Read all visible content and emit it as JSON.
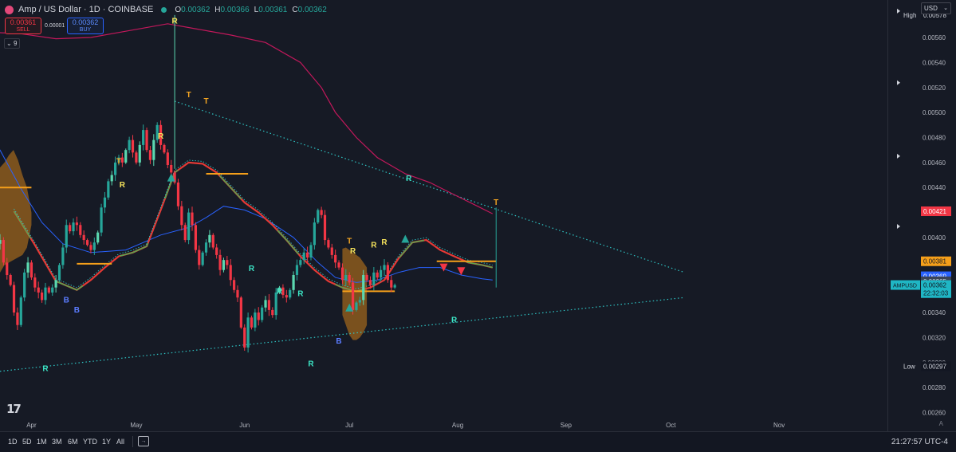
{
  "header": {
    "symbol_title": "Amp / US Dollar · 1D · COINBASE",
    "ohlc": [
      {
        "key": "O",
        "value": "0.00362"
      },
      {
        "key": "H",
        "value": "0.00366"
      },
      {
        "key": "L",
        "value": "0.00361"
      },
      {
        "key": "C",
        "value": "0.00362"
      }
    ],
    "sell_price": "0.00361",
    "sell_label": "SELL",
    "buy_price": "0.00362",
    "buy_label": "BUY",
    "spread": "0.00001",
    "indicator_count": "9",
    "currency": "USD"
  },
  "time_range_buttons": [
    "1D",
    "5D",
    "1M",
    "3M",
    "6M",
    "YTD",
    "1Y",
    "All"
  ],
  "clock": "21:27:57 UTC-4",
  "colors": {
    "background": "#161a25",
    "up": "#26a69a",
    "up_light": "#5bd8b0",
    "down": "#f23645",
    "ma_slow": "#c2185b",
    "ma_mid": "#2962ff",
    "ma_fast_up": "#4caf50",
    "ma_fast_down": "#e53935",
    "trendline": "#2ec4c4",
    "level_orange": "#f59f1a",
    "signal_T": "#f5a623",
    "signal_R_up": "#3ce6c6",
    "signal_R_top": "#f5e25b",
    "signal_B": "#5b7cff"
  },
  "chart_data": {
    "type": "candlestick",
    "title": "Amp / US Dollar · 1D · COINBASE",
    "symbol": "AMPUSD",
    "y_axis": {
      "ticks": [
        "0.00560",
        "0.00540",
        "0.00520",
        "0.00500",
        "0.00480",
        "0.00460",
        "0.00440",
        "0.00420",
        "0.00400",
        "0.00380",
        "0.00360",
        "0.00340",
        "0.00320",
        "0.00300",
        "0.00280",
        "0.00260"
      ],
      "ylim": [
        0.00245,
        0.0059
      ]
    },
    "x_axis": {
      "ticks": [
        {
          "label": "Apr",
          "day": 13
        },
        {
          "label": "May",
          "day": 43
        },
        {
          "label": "Jun",
          "day": 74
        },
        {
          "label": "Jul",
          "day": 104
        },
        {
          "label": "Aug",
          "day": 135
        },
        {
          "label": "Sep",
          "day": 166
        },
        {
          "label": "Oct",
          "day": 196
        },
        {
          "label": "Nov",
          "day": 227
        }
      ],
      "xlim": [
        4,
        258
      ]
    },
    "price_labels": [
      {
        "text": "0.00578",
        "prefix": "High",
        "value": 0.00578,
        "kind": "high"
      },
      {
        "text": "0.00421",
        "value": 0.00421,
        "kind": "red"
      },
      {
        "text": "0.00381",
        "value": 0.00381,
        "kind": "orange"
      },
      {
        "text": "0.00369",
        "value": 0.00369,
        "kind": "blue"
      },
      {
        "text": "0.00365",
        "value": 0.00365,
        "kind": "slate"
      },
      {
        "text": "0.00362",
        "value": 0.00362,
        "kind": "cyan"
      },
      {
        "text": "22:32:03",
        "value": 0.003555,
        "kind": "cyan-time"
      },
      {
        "text": "0.00297",
        "prefix": "Low",
        "value": 0.00297,
        "kind": "low"
      }
    ],
    "symbol_tag": {
      "text": "AMPUSD",
      "value": 0.00362
    },
    "closes": [
      0.00418,
      0.00428,
      0.0041,
      0.0042,
      0.00412,
      0.004,
      0.00415,
      0.00395,
      0.00398,
      0.0038,
      0.0037,
      0.00362,
      0.0034,
      0.0033,
      0.00352,
      0.00372,
      0.0038,
      0.00368,
      0.0036,
      0.00356,
      0.0035,
      0.0036,
      0.00356,
      0.0036,
      0.00366,
      0.00378,
      0.00392,
      0.0041,
      0.00405,
      0.00412,
      0.0041,
      0.00402,
      0.00398,
      0.00394,
      0.0039,
      0.00396,
      0.00404,
      0.00424,
      0.00432,
      0.00445,
      0.0045,
      0.0046,
      0.00464,
      0.0046,
      0.0047,
      0.00478,
      0.00468,
      0.0046,
      0.00474,
      0.00486,
      0.0047,
      0.00462,
      0.00478,
      0.0049,
      0.00474,
      0.00468,
      0.00458,
      0.00452,
      0.00444,
      0.00425,
      0.0041,
      0.00398,
      0.0042,
      0.0041,
      0.0039,
      0.00378,
      0.00388,
      0.00396,
      0.00402,
      0.00392,
      0.00386,
      0.00374,
      0.00382,
      0.00378,
      0.00366,
      0.00358,
      0.00352,
      0.00328,
      0.00312,
      0.00336,
      0.00328,
      0.0034,
      0.00334,
      0.00344,
      0.0035,
      0.00342,
      0.00338,
      0.00356,
      0.0036,
      0.00354,
      0.00352,
      0.00358,
      0.0037,
      0.00378,
      0.00382,
      0.00388,
      0.00384,
      0.00394,
      0.00412,
      0.00422,
      0.00418,
      0.00398,
      0.00392,
      0.00386,
      0.0038,
      0.00376,
      0.00366,
      0.0037,
      0.00364,
      0.00342,
      0.00348,
      0.0035,
      0.0037,
      0.00366,
      0.00362,
      0.00372,
      0.00368,
      0.00374,
      0.00378,
      0.00366,
      0.0036,
      0.00362
    ],
    "first_close_day": -4,
    "moving_averages": [
      {
        "name": "MA slow",
        "color_key": "ma_slow",
        "points": [
          [
            -4,
            0.00565
          ],
          [
            10,
            0.00563
          ],
          [
            20,
            0.00559
          ],
          [
            30,
            0.0056
          ],
          [
            40,
            0.00565
          ],
          [
            52,
            0.00571
          ],
          [
            60,
            0.00567
          ],
          [
            70,
            0.00562
          ],
          [
            80,
            0.00556
          ],
          [
            90,
            0.0054
          ],
          [
            96,
            0.0052
          ],
          [
            100,
            0.005
          ],
          [
            106,
            0.0048
          ],
          [
            112,
            0.00464
          ],
          [
            120,
            0.00451
          ],
          [
            127,
            0.00444
          ],
          [
            132,
            0.00437
          ],
          [
            140,
            0.00426
          ],
          [
            145,
            0.00419
          ]
        ]
      },
      {
        "name": "MA mid",
        "color_key": "ma_mid",
        "points": [
          [
            -4,
            0.00501
          ],
          [
            4,
            0.0047
          ],
          [
            10,
            0.00439
          ],
          [
            16,
            0.00412
          ],
          [
            22,
            0.00395
          ],
          [
            30,
            0.00388
          ],
          [
            40,
            0.0039
          ],
          [
            50,
            0.00402
          ],
          [
            58,
            0.00408
          ],
          [
            63,
            0.00416
          ],
          [
            68,
            0.00425
          ],
          [
            74,
            0.00422
          ],
          [
            80,
            0.00415
          ],
          [
            88,
            0.004
          ],
          [
            95,
            0.0038
          ],
          [
            100,
            0.00368
          ],
          [
            106,
            0.00364
          ],
          [
            112,
            0.00366
          ],
          [
            118,
            0.00372
          ],
          [
            124,
            0.00376
          ],
          [
            130,
            0.00376
          ],
          [
            136,
            0.0037
          ],
          [
            142,
            0.00367
          ],
          [
            145,
            0.00366
          ]
        ]
      },
      {
        "name": "MA fast",
        "color_key": "ma_fast_down",
        "points": [
          [
            8,
            0.00421
          ],
          [
            14,
            0.00394
          ],
          [
            20,
            0.00365
          ],
          [
            26,
            0.00358
          ],
          [
            30,
            0.00366
          ],
          [
            34,
            0.00376
          ],
          [
            38,
            0.00385
          ],
          [
            42,
            0.00388
          ],
          [
            46,
            0.00393
          ],
          [
            50,
            0.00422
          ],
          [
            54,
            0.00452
          ],
          [
            58,
            0.0046
          ],
          [
            62,
            0.00459
          ],
          [
            66,
            0.00452
          ],
          [
            70,
            0.0044
          ],
          [
            74,
            0.00428
          ],
          [
            78,
            0.0042
          ],
          [
            82,
            0.0041
          ],
          [
            86,
            0.00398
          ],
          [
            90,
            0.00385
          ],
          [
            94,
            0.00374
          ],
          [
            98,
            0.00365
          ],
          [
            102,
            0.0036
          ],
          [
            106,
            0.00357
          ],
          [
            110,
            0.0036
          ],
          [
            114,
            0.00366
          ],
          [
            118,
            0.00383
          ],
          [
            122,
            0.00396
          ],
          [
            126,
            0.00398
          ],
          [
            130,
            0.0039
          ],
          [
            134,
            0.00385
          ],
          [
            138,
            0.0038
          ],
          [
            142,
            0.00378
          ],
          [
            145,
            0.00376
          ]
        ]
      }
    ],
    "trendlines": [
      {
        "name": "upper",
        "from": [
          54,
          0.00509
        ],
        "to": [
          200,
          0.00372
        ]
      },
      {
        "name": "lower",
        "from": [
          4,
          0.00293
        ],
        "to": [
          200,
          0.00352
        ]
      }
    ],
    "levels": [
      {
        "value": 0.0044,
        "from": 4,
        "to": 13
      },
      {
        "value": 0.00379,
        "from": 26,
        "to": 36
      },
      {
        "value": 0.00451,
        "from": 63,
        "to": 75
      },
      {
        "value": 0.00357,
        "from": 102,
        "to": 117
      },
      {
        "value": 0.00381,
        "from": 129,
        "to": 146
      }
    ],
    "cloud_bands": [
      {
        "from": 4,
        "to": 13,
        "top": [
          0.00456,
          0.0046,
          0.00466,
          0.0047,
          0.00462,
          0.0045,
          0.0044,
          0.0042
        ],
        "bottom": [
          0.00372,
          0.00378,
          0.0038,
          0.00382,
          0.00384,
          0.00386,
          0.00392,
          0.0041
        ]
      },
      {
        "from": 102,
        "to": 109,
        "top": [
          0.00391,
          0.00392,
          0.0039,
          0.00388,
          0.00386,
          0.00384,
          0.0038,
          0.00376
        ],
        "bottom": [
          0.00338,
          0.0033,
          0.00322,
          0.00318,
          0.00318,
          0.0032,
          0.00324,
          0.0033
        ]
      }
    ],
    "signals": [
      {
        "text": "R",
        "day": 54,
        "value": 0.00573,
        "color_key": "signal_R_top"
      },
      {
        "text": "T",
        "day": 58,
        "value": 0.00514,
        "color_key": "signal_T"
      },
      {
        "text": "T",
        "day": 63,
        "value": 0.00509,
        "color_key": "signal_T"
      },
      {
        "text": "R",
        "day": 50,
        "value": 0.00481,
        "color_key": "signal_R_top"
      },
      {
        "text": "T",
        "day": 38,
        "value": 0.00461,
        "color_key": "signal_T"
      },
      {
        "text": "R",
        "day": 39,
        "value": 0.00442,
        "color_key": "signal_R_top"
      },
      {
        "text": "R",
        "day": 121,
        "value": 0.00447,
        "color_key": "signal_R_up"
      },
      {
        "text": "T",
        "day": 146,
        "value": 0.00428,
        "color_key": "signal_T"
      },
      {
        "text": "T",
        "day": 104,
        "value": 0.00397,
        "color_key": "signal_T"
      },
      {
        "text": "R",
        "day": 105,
        "value": 0.00389,
        "color_key": "signal_R_top"
      },
      {
        "text": "R",
        "day": 111,
        "value": 0.00394,
        "color_key": "signal_R_top"
      },
      {
        "text": "R",
        "day": 114,
        "value": 0.00396,
        "color_key": "signal_R_top"
      },
      {
        "text": "R",
        "day": 76,
        "value": 0.00375,
        "color_key": "signal_R_up"
      },
      {
        "text": "R",
        "day": 84,
        "value": 0.00357,
        "color_key": "signal_R_up"
      },
      {
        "text": "R",
        "day": 90,
        "value": 0.00355,
        "color_key": "signal_R_up"
      },
      {
        "text": "R",
        "day": 134,
        "value": 0.00334,
        "color_key": "signal_R_up"
      },
      {
        "text": "R",
        "day": 93,
        "value": 0.00299,
        "color_key": "signal_R_up"
      },
      {
        "text": "R",
        "day": 17,
        "value": 0.00295,
        "color_key": "signal_R_up"
      },
      {
        "text": "B",
        "day": 23,
        "value": 0.0035,
        "color_key": "signal_B"
      },
      {
        "text": "B",
        "day": 26,
        "value": 0.00342,
        "color_key": "signal_B"
      },
      {
        "text": "B",
        "day": 101,
        "value": 0.00317,
        "color_key": "signal_B"
      }
    ],
    "markers": [
      {
        "shape": "triangle-up",
        "day": 53,
        "value": 0.00448,
        "color_key": "up"
      },
      {
        "shape": "triangle-up",
        "day": 120,
        "value": 0.00399,
        "color_key": "up"
      },
      {
        "shape": "triangle-up",
        "day": 104,
        "value": 0.00344,
        "color_key": "up"
      },
      {
        "shape": "triangle-down",
        "day": 131,
        "value": 0.00376,
        "color_key": "down"
      },
      {
        "shape": "triangle-down",
        "day": 136,
        "value": 0.00373,
        "color_key": "down"
      }
    ]
  }
}
